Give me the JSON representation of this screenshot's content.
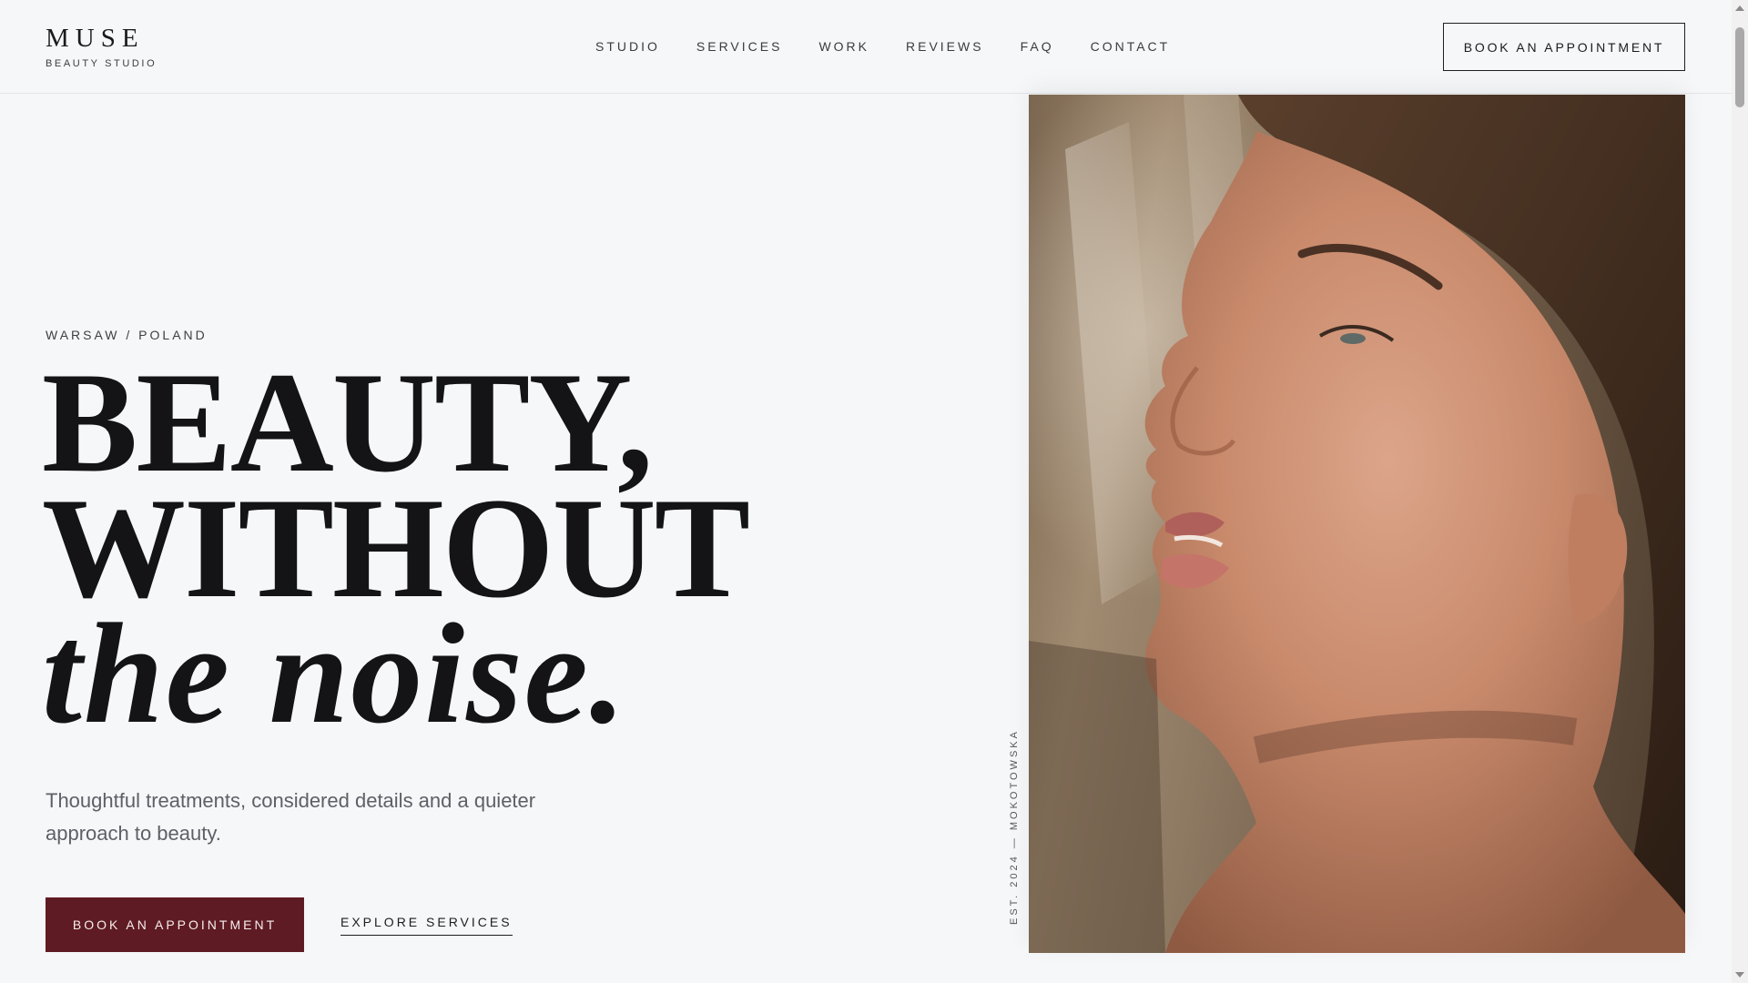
{
  "brand": {
    "name": "MUSE",
    "tagline": "BEAUTY STUDIO"
  },
  "nav": {
    "items": [
      {
        "label": "STUDIO"
      },
      {
        "label": "SERVICES"
      },
      {
        "label": "WORK"
      },
      {
        "label": "REVIEWS"
      },
      {
        "label": "FAQ"
      },
      {
        "label": "CONTACT"
      }
    ],
    "cta_label": "BOOK AN APPOINTMENT"
  },
  "hero": {
    "eyebrow": "WARSAW / POLAND",
    "headline": {
      "line1": "BEAUTY,",
      "line2": "WITHOUT",
      "line3": "the noise."
    },
    "lede": "Thoughtful treatments, considered details and a quieter approach to beauty.",
    "primary_cta": "BOOK AN APPOINTMENT",
    "secondary_cta": "EXPLORE SERVICES",
    "vertical_tag": "EST. 2024 — MOKOTOWSKA",
    "image_icon": "portrait-photo"
  },
  "colors": {
    "accent": "#5f1b23",
    "background": "#f6f7f9",
    "text": "#141417"
  }
}
